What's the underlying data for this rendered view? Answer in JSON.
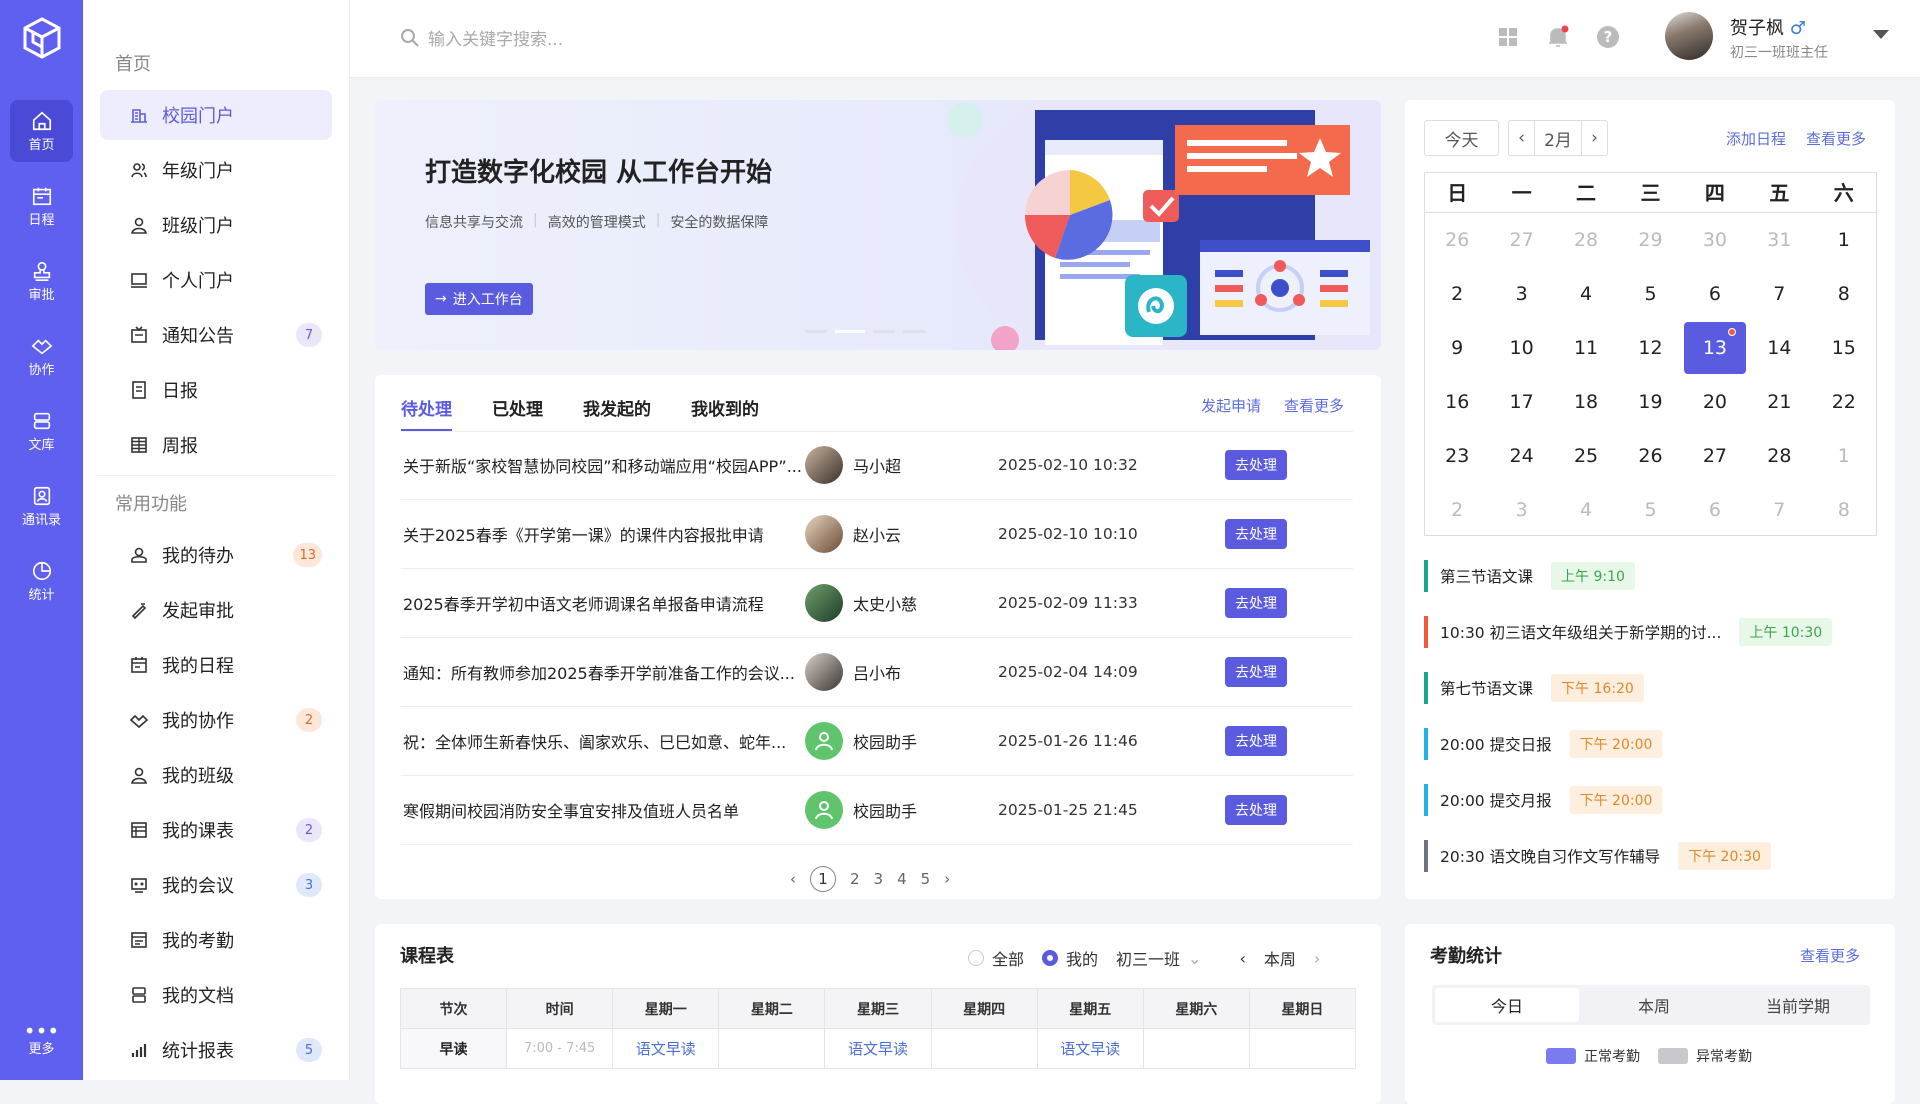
{
  "rail": {
    "items": [
      {
        "label": "首页",
        "icon": "home-icon"
      },
      {
        "label": "日程",
        "icon": "calendar-icon"
      },
      {
        "label": "审批",
        "icon": "stamp-icon"
      },
      {
        "label": "协作",
        "icon": "handshake-icon"
      },
      {
        "label": "文库",
        "icon": "library-icon"
      },
      {
        "label": "通讯录",
        "icon": "contacts-icon"
      },
      {
        "label": "统计",
        "icon": "pie-chart-icon"
      }
    ],
    "more": "更多"
  },
  "sidebar": {
    "section1": "首页",
    "items1": [
      {
        "label": "校园门户"
      },
      {
        "label": "年级门户"
      },
      {
        "label": "班级门户"
      },
      {
        "label": "个人门户"
      },
      {
        "label": "通知公告",
        "badge": "7"
      },
      {
        "label": "日报"
      },
      {
        "label": "周报"
      }
    ],
    "section2": "常用功能",
    "items2": [
      {
        "label": "我的待办",
        "badge": "13"
      },
      {
        "label": "发起审批"
      },
      {
        "label": "我的日程"
      },
      {
        "label": "我的协作",
        "badge": "2"
      },
      {
        "label": "我的班级"
      },
      {
        "label": "我的课表",
        "badge": "2"
      },
      {
        "label": "我的会议",
        "badge": "3"
      },
      {
        "label": "我的考勤"
      },
      {
        "label": "我的文档"
      },
      {
        "label": "统计报表",
        "badge": "5"
      }
    ]
  },
  "header": {
    "search_placeholder": "输入关键字搜索...",
    "user_name": "贺子枫",
    "gender_symbol": "♂",
    "user_role": "初三一班班主任"
  },
  "banner": {
    "title": "打造数字化校园 从工作台开始",
    "features": [
      "信息共享与交流",
      "高效的管理模式",
      "安全的数据保障"
    ],
    "button": "进入工作台"
  },
  "todo": {
    "tabs": [
      "待处理",
      "已处理",
      "我发起的",
      "我收到的"
    ],
    "apply_link": "发起申请",
    "more_link": "查看更多",
    "action_label": "去处理",
    "rows": [
      {
        "title": "关于新版“家校智慧协同校园”和移动端应用“校园APP”...",
        "user": "马小超",
        "time": "2025-02-10 10:32"
      },
      {
        "title": "关于2025春季《开学第一课》的课件内容报批申请",
        "user": "赵小云",
        "time": "2025-02-10 10:10"
      },
      {
        "title": "2025春季开学初中语文老师调课名单报备申请流程",
        "user": "太史小慈",
        "time": "2025-02-09 11:33"
      },
      {
        "title": "通知：所有教师参加2025春季开学前准备工作的会议...",
        "user": "吕小布",
        "time": "2025-02-04 14:09"
      },
      {
        "title": "祝：全体师生新春快乐、阖家欢乐、巳巳如意、蛇年...",
        "user": "校园助手",
        "time": "2025-01-26 11:46"
      },
      {
        "title": "寒假期间校园消防安全事宜安排及值班人员名单",
        "user": "校园助手",
        "time": "2025-01-25 21:45"
      }
    ],
    "pages": [
      "1",
      "2",
      "3",
      "4",
      "5"
    ]
  },
  "calendar": {
    "today_btn": "今天",
    "month": "2月",
    "add_link": "添加日程",
    "more_link": "查看更多",
    "weekdays": [
      "日",
      "一",
      "二",
      "三",
      "四",
      "五",
      "六"
    ],
    "days": [
      "26",
      "27",
      "28",
      "29",
      "30",
      "31",
      "1",
      "2",
      "3",
      "4",
      "5",
      "6",
      "7",
      "8",
      "9",
      "10",
      "11",
      "12",
      "13",
      "14",
      "15",
      "16",
      "17",
      "18",
      "19",
      "20",
      "21",
      "22",
      "23",
      "24",
      "25",
      "26",
      "27",
      "28",
      "1",
      "2",
      "3",
      "4",
      "5",
      "6",
      "7",
      "8"
    ],
    "today": "13",
    "events": [
      {
        "title": "第三节语文课",
        "tag": "上午 9:10",
        "color": "#1aa58a",
        "tag_style": "g"
      },
      {
        "title": "10:30 初三语文年级组关于新学期的讨...",
        "tag": "上午 10:30",
        "color": "#f2593a",
        "tag_style": "g"
      },
      {
        "title": "第七节语文课",
        "tag": "下午 16:20",
        "color": "#1aa58a",
        "tag_style": "o"
      },
      {
        "title": "20:00 提交日报",
        "tag": "下午 20:00",
        "color": "#22b4e6",
        "tag_style": "o"
      },
      {
        "title": "20:00 提交月报",
        "tag": "下午 20:00",
        "color": "#22b4e6",
        "tag_style": "o"
      },
      {
        "title": "20:30 语文晚自习作文写作辅导",
        "tag": "下午 20:30",
        "color": "#6b7280",
        "tag_style": "o"
      }
    ]
  },
  "schedule": {
    "title": "课程表",
    "filter_all": "全部",
    "filter_mine": "我的",
    "class": "初三一班",
    "week": "本周",
    "headers": [
      "节次",
      "时间",
      "星期一",
      "星期二",
      "星期三",
      "星期四",
      "星期五",
      "星期六",
      "星期日"
    ],
    "row1": [
      "早读",
      "7:00 - 7:45",
      "语文早读",
      "",
      "语文早读",
      "",
      "语文早读",
      "",
      ""
    ]
  },
  "attendance": {
    "title": "考勤统计",
    "more_link": "查看更多",
    "tabs": [
      "今日",
      "本周",
      "当前学期"
    ],
    "legend_normal": "正常考勤",
    "legend_abnormal": "异常考勤"
  }
}
